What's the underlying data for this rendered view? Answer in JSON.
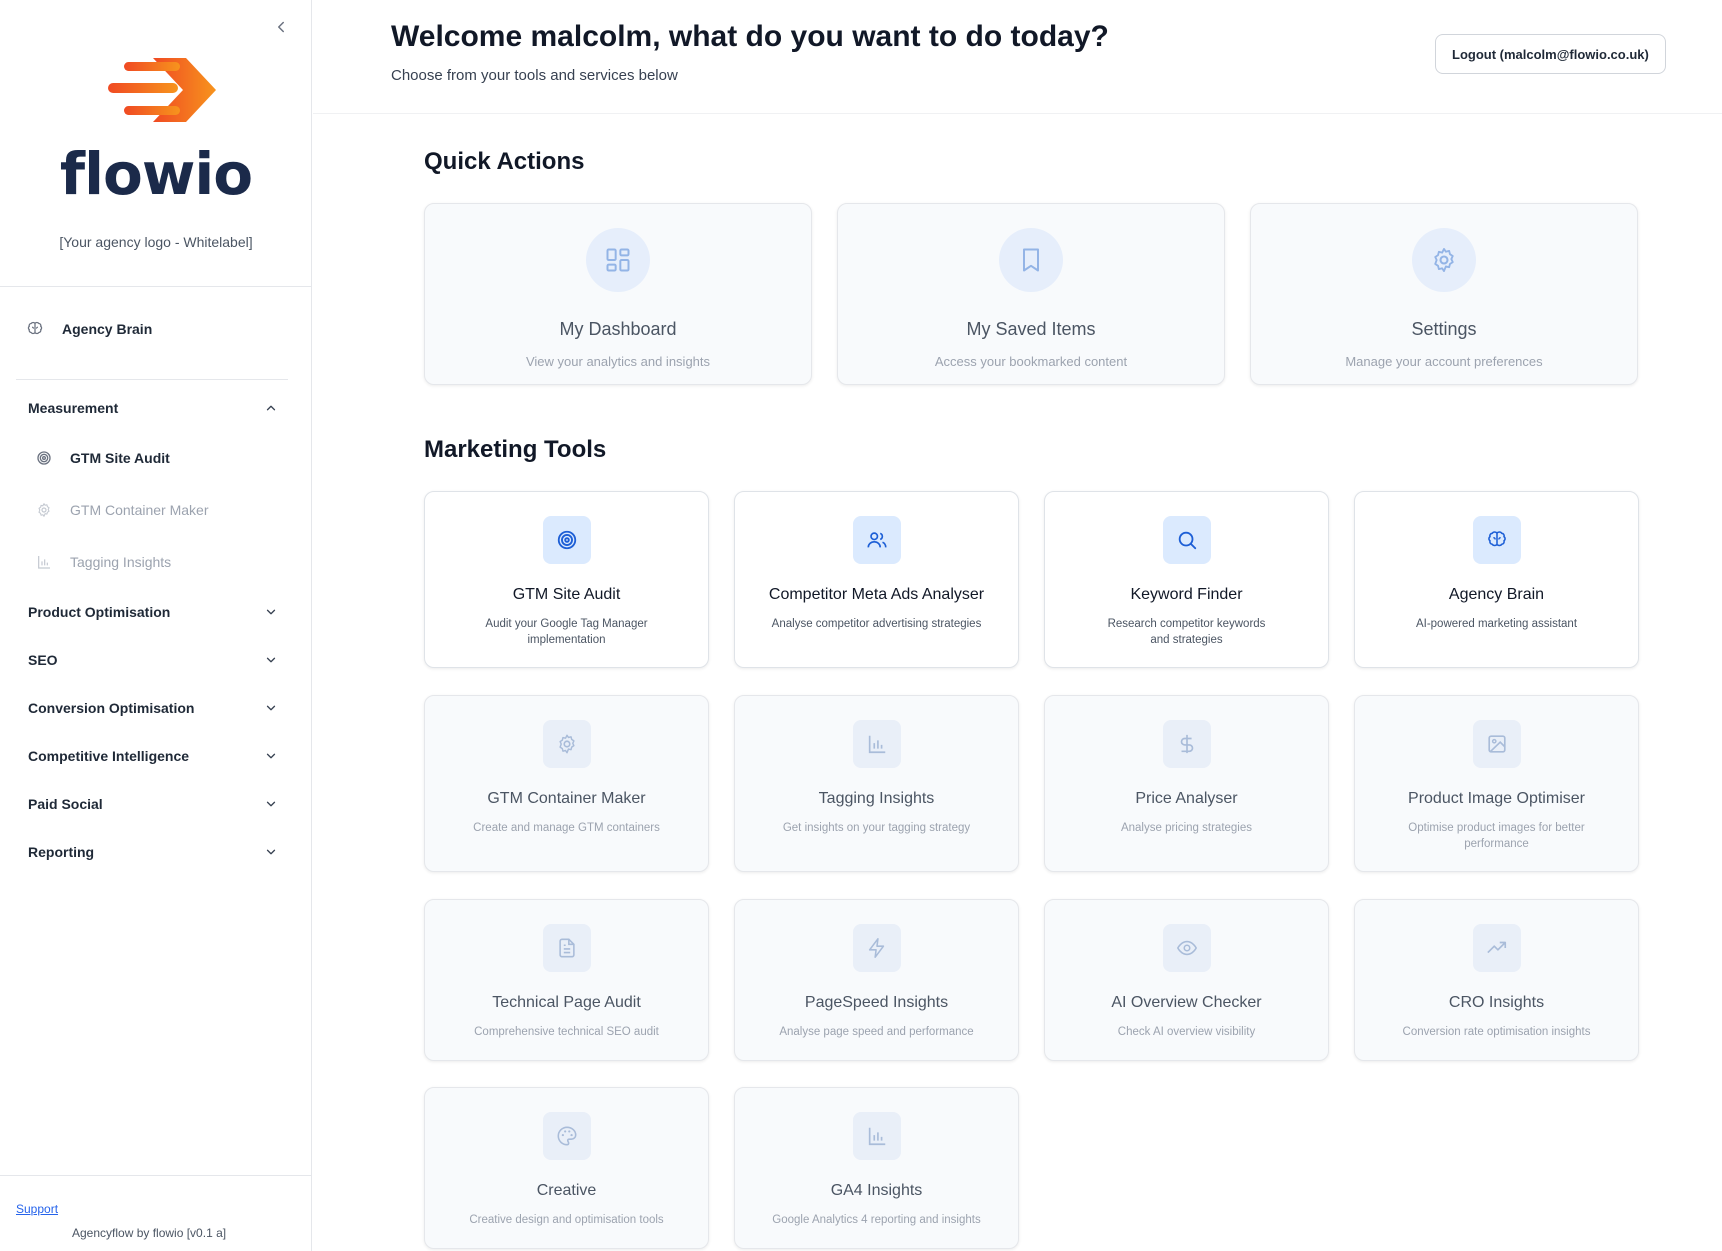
{
  "brand": {
    "logo_text": "flowio",
    "agency_logo_text": "[Your agency logo - Whitelabel]",
    "colors": {
      "logo_orange": "#f26a21",
      "logo_navy": "#1b2a4a",
      "accent_blue": "#1d5fd6"
    }
  },
  "sidebar": {
    "agency_brain": "Agency Brain",
    "sections": [
      {
        "label": "Measurement",
        "expanded": true
      },
      {
        "label": "Product Optimisation",
        "expanded": false
      },
      {
        "label": "SEO",
        "expanded": false
      },
      {
        "label": "Conversion Optimisation",
        "expanded": false
      },
      {
        "label": "Competitive Intelligence",
        "expanded": false
      },
      {
        "label": "Paid Social",
        "expanded": false
      },
      {
        "label": "Reporting",
        "expanded": false
      }
    ],
    "measurement_items": [
      {
        "label": "GTM Site Audit",
        "icon": "target-icon",
        "active": true
      },
      {
        "label": "GTM Container Maker",
        "icon": "gear-icon",
        "active": false
      },
      {
        "label": "Tagging Insights",
        "icon": "bar-chart-icon",
        "active": false
      }
    ],
    "support": "Support",
    "version": "Agencyflow by flowio [v0.1 a]"
  },
  "header": {
    "welcome": "Welcome malcolm, what do you want to do today?",
    "subtitle": "Choose from your tools and services below",
    "logout": "Logout (malcolm@flowio.co.uk)"
  },
  "quick_actions": {
    "title": "Quick Actions",
    "cards": [
      {
        "title": "My Dashboard",
        "desc": "View your analytics and insights",
        "icon": "dashboard-icon"
      },
      {
        "title": "My Saved Items",
        "desc": "Access your bookmarked content",
        "icon": "bookmark-icon"
      },
      {
        "title": "Settings",
        "desc": "Manage your account preferences",
        "icon": "gear-icon"
      }
    ]
  },
  "marketing_tools": {
    "title": "Marketing Tools",
    "cards": [
      {
        "title": "GTM Site Audit",
        "desc": "Audit your Google Tag Manager implementation",
        "icon": "target-icon",
        "active": true
      },
      {
        "title": "Competitor Meta Ads Analyser",
        "desc": "Analyse competitor advertising strategies",
        "icon": "users-icon",
        "active": true
      },
      {
        "title": "Keyword Finder",
        "desc": "Research competitor keywords and strategies",
        "icon": "search-icon",
        "active": true
      },
      {
        "title": "Agency Brain",
        "desc": "AI-powered marketing assistant",
        "icon": "brain-icon",
        "active": true
      },
      {
        "title": "GTM Container Maker",
        "desc": "Create and manage GTM containers",
        "icon": "gear-icon",
        "active": false
      },
      {
        "title": "Tagging Insights",
        "desc": "Get insights on your tagging strategy",
        "icon": "bar-chart-icon",
        "active": false
      },
      {
        "title": "Price Analyser",
        "desc": "Analyse pricing strategies",
        "icon": "dollar-icon",
        "active": false
      },
      {
        "title": "Product Image Optimiser",
        "desc": "Optimise product images for better performance",
        "icon": "image-icon",
        "active": false
      },
      {
        "title": "Technical Page Audit",
        "desc": "Comprehensive technical SEO audit",
        "icon": "document-icon",
        "active": false
      },
      {
        "title": "PageSpeed Insights",
        "desc": "Analyse page speed and performance",
        "icon": "lightning-icon",
        "active": false
      },
      {
        "title": "AI Overview Checker",
        "desc": "Check AI overview visibility",
        "icon": "eye-icon",
        "active": false
      },
      {
        "title": "CRO Insights",
        "desc": "Conversion rate optimisation insights",
        "icon": "trending-up-icon",
        "active": false
      },
      {
        "title": "Creative",
        "desc": "Creative design and optimisation tools",
        "icon": "palette-icon",
        "active": false
      },
      {
        "title": "GA4 Insights",
        "desc": "Google Analytics 4 reporting and insights",
        "icon": "bar-chart-icon",
        "active": false
      }
    ]
  }
}
